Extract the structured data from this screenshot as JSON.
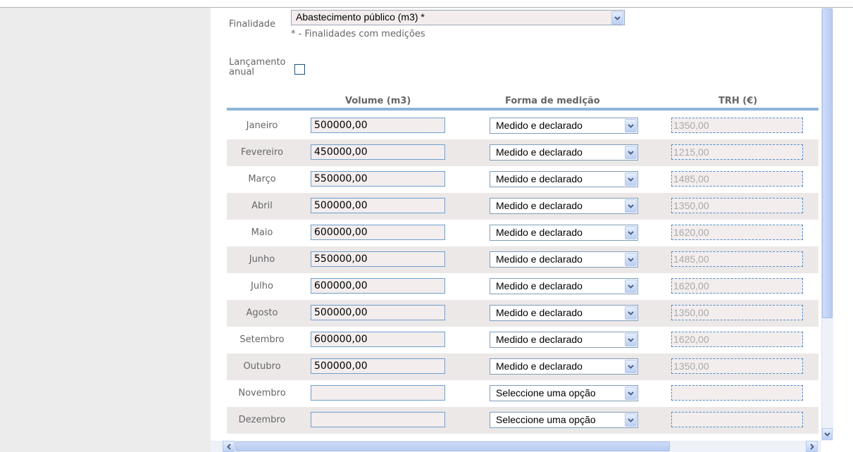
{
  "form": {
    "finalidade_label": "Finalidade",
    "finalidade_value": "Abastecimento público (m3) *",
    "finalidade_hint": "* - Finalidades com medições",
    "lancamento_label": "Lançamento anual",
    "lancamento_checked": false
  },
  "table": {
    "headers": {
      "volume": "Volume (m3)",
      "forma": "Forma de medição",
      "trh": "TRH (€)"
    },
    "rows": [
      {
        "month": "Janeiro",
        "volume": "500000,00",
        "forma": "Medido e declarado",
        "trh": "1350,00"
      },
      {
        "month": "Fevereiro",
        "volume": "450000,00",
        "forma": "Medido e declarado",
        "trh": "1215,00"
      },
      {
        "month": "Março",
        "volume": "550000,00",
        "forma": "Medido e declarado",
        "trh": "1485,00"
      },
      {
        "month": "Abril",
        "volume": "500000,00",
        "forma": "Medido e declarado",
        "trh": "1350,00"
      },
      {
        "month": "Maio",
        "volume": "600000,00",
        "forma": "Medido e declarado",
        "trh": "1620,00"
      },
      {
        "month": "Junho",
        "volume": "550000,00",
        "forma": "Medido e declarado",
        "trh": "1485,00"
      },
      {
        "month": "Julho",
        "volume": "600000,00",
        "forma": "Medido e declarado",
        "trh": "1620,00"
      },
      {
        "month": "Agosto",
        "volume": "500000,00",
        "forma": "Medido e declarado",
        "trh": "1350,00"
      },
      {
        "month": "Setembro",
        "volume": "600000,00",
        "forma": "Medido e declarado",
        "trh": "1620,00"
      },
      {
        "month": "Outubro",
        "volume": "500000,00",
        "forma": "Medido e declarado",
        "trh": "1350,00"
      },
      {
        "month": "Novembro",
        "volume": "",
        "forma": "Seleccione uma opção",
        "trh": ""
      },
      {
        "month": "Dezembro",
        "volume": "",
        "forma": "Seleccione uma opção",
        "trh": ""
      }
    ]
  },
  "icons": {
    "dropdown": "chevron-down-icon",
    "scroll_left": "arrow-left-icon",
    "scroll_right": "arrow-right-icon",
    "scroll_down": "arrow-down-icon"
  },
  "colors": {
    "header_rule": "#8fb5d9",
    "alt_row": "#ece8e8",
    "field_bg": "#f3eded"
  }
}
